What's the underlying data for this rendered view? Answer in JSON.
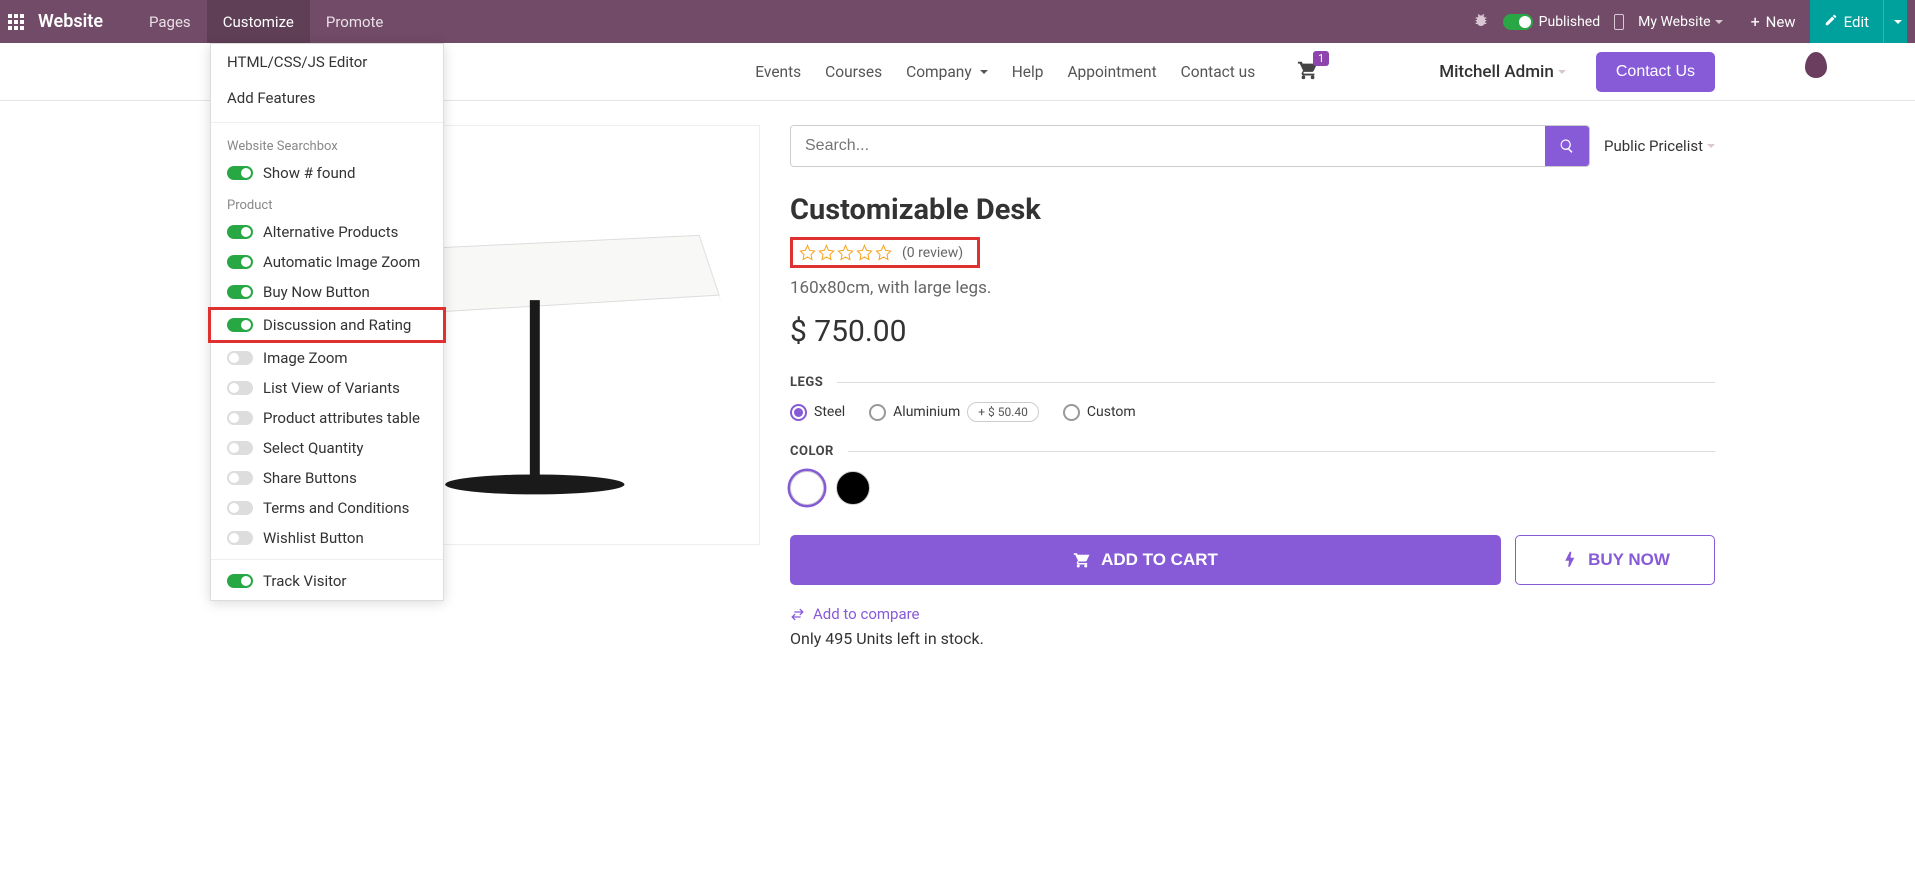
{
  "topbar": {
    "brand": "Website",
    "menu": [
      "Pages",
      "Customize",
      "Promote"
    ],
    "published": "Published",
    "mywebsite": "My Website",
    "new": "New",
    "edit": "Edit"
  },
  "siteheader": {
    "nav": [
      "Events",
      "Courses",
      "Company",
      "Help",
      "Appointment",
      "Contact us"
    ],
    "cart_badge": "1",
    "user": "Mitchell Admin",
    "contact_btn": "Contact Us"
  },
  "customize_menu": {
    "top_items": [
      "HTML/CSS/JS Editor",
      "Add Features"
    ],
    "section_searchbox": "Website Searchbox",
    "show_found": "Show # found",
    "section_product": "Product",
    "product_toggles": [
      {
        "label": "Alternative Products",
        "on": true
      },
      {
        "label": "Automatic Image Zoom",
        "on": true
      },
      {
        "label": "Buy Now Button",
        "on": true
      },
      {
        "label": "Discussion and Rating",
        "on": true,
        "highlight": true
      },
      {
        "label": "Image Zoom",
        "on": false
      },
      {
        "label": "List View of Variants",
        "on": false
      },
      {
        "label": "Product attributes table",
        "on": false
      },
      {
        "label": "Select Quantity",
        "on": false
      },
      {
        "label": "Share Buttons",
        "on": false
      },
      {
        "label": "Terms and Conditions",
        "on": false
      },
      {
        "label": "Wishlist Button",
        "on": false
      }
    ],
    "track_visitor": "Track Visitor"
  },
  "search": {
    "placeholder": "Search...",
    "pricelist": "Public Pricelist"
  },
  "product": {
    "title": "Customizable Desk",
    "review_count": "(0 review)",
    "desc": "160x80cm, with large legs.",
    "price": "$ 750.00",
    "legs_label": "LEGS",
    "legs_options": [
      {
        "label": "Steel",
        "selected": true
      },
      {
        "label": "Aluminium",
        "extra": "+  $ 50.40"
      },
      {
        "label": "Custom"
      }
    ],
    "color_label": "COLOR",
    "add_to_cart": "ADD TO CART",
    "buy_now": "BUY NOW",
    "compare": "Add to compare",
    "stock": "Only 495 Units left in stock."
  }
}
